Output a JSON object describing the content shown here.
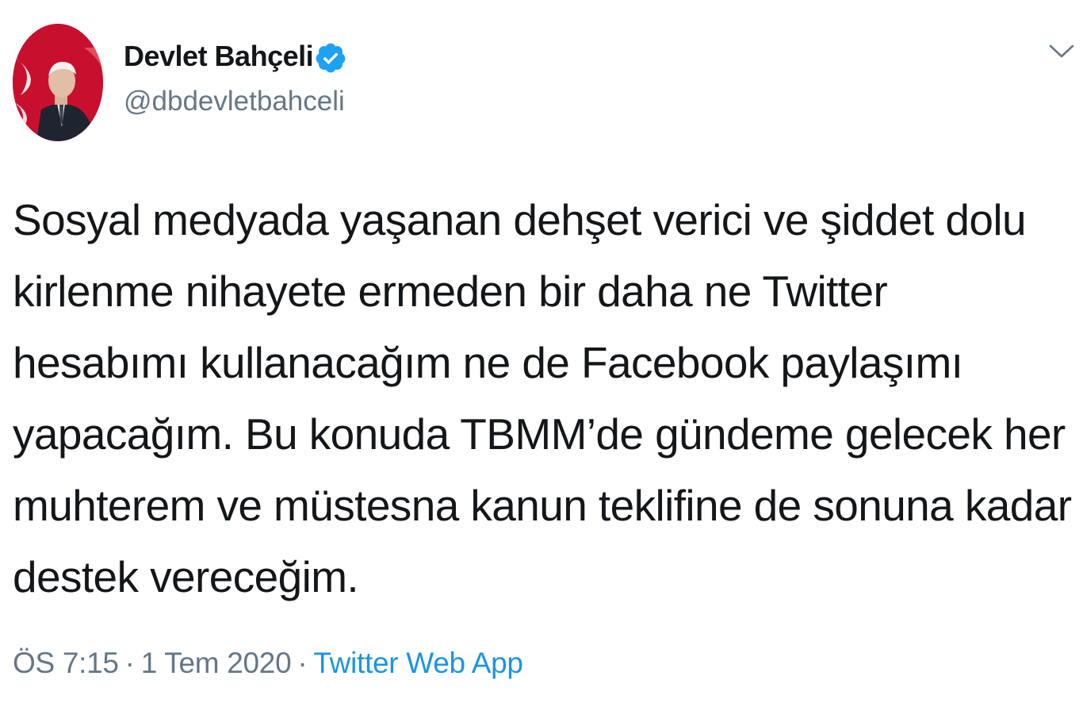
{
  "tweet": {
    "author": {
      "display_name": "Devlet Bahçeli",
      "handle": "@dbdevletbahceli",
      "verified": true,
      "avatar_icon": "profile-photo"
    },
    "menu_icon": "chevron-down-icon",
    "text_lines": [
      "Sosyal medyada yaşanan dehşet verici ve şiddet dolu",
      "kirlenme nihayete ermeden bir daha ne Twitter",
      "hesabımı kullanacağım ne de Facebook paylaşımı",
      "yapacağım. Bu konuda TBMM’de gündeme gelecek her",
      "muhterem ve müstesna kanun teklifine de sonuna kadar",
      "destek vereceğim."
    ],
    "time": "ÖS 7:15",
    "separator": "·",
    "date": "1 Tem 2020",
    "source": "Twitter Web App"
  },
  "colors": {
    "text": "#14171a",
    "secondary": "#657786",
    "link": "#1b95e0",
    "verified": "#1da1f2"
  }
}
